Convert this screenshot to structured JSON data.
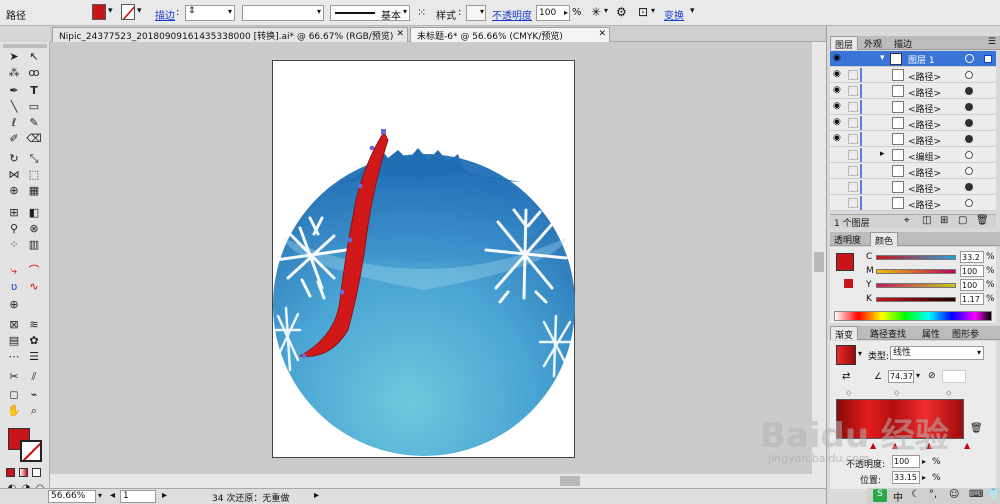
{
  "control_bar": {
    "object_type": "路径",
    "stroke_label": "描边",
    "brush_label": "基本",
    "style_label": "样式",
    "opacity_label": "不透明度",
    "opacity_value": "100",
    "opacity_unit": "%",
    "transform_label": "变换"
  },
  "document_tabs": [
    {
      "label": "Nipic_24377523_20180909161435338000 [转换].ai* @ 66.67% (RGB/预览)"
    },
    {
      "label": "未标题-6* @ 56.66% (CMYK/预览)"
    }
  ],
  "status_bar": {
    "zoom": "56.66%",
    "page": "1",
    "undo_text": "34 次还原：无重做"
  },
  "layers_panel": {
    "tabs": [
      "图层",
      "外观",
      "描边"
    ],
    "layer_name": "图层 1",
    "items": [
      {
        "label": "<路径>",
        "target": "hollow"
      },
      {
        "label": "<路径>",
        "target": "filled"
      },
      {
        "label": "<路径>",
        "target": "filled"
      },
      {
        "label": "<路径>",
        "target": "filled"
      },
      {
        "label": "<路径>",
        "target": "filled"
      },
      {
        "label": "<编组>",
        "target": "hollow"
      },
      {
        "label": "<路径>",
        "target": "hollow"
      },
      {
        "label": "<路径>",
        "target": "filled"
      },
      {
        "label": "<路径>",
        "target": "hollow"
      }
    ],
    "footer": "1 个图层"
  },
  "color_panel": {
    "tabs": [
      "透明度",
      "颜色"
    ],
    "sliders": [
      {
        "label": "C",
        "value": "33.2",
        "unit": "%"
      },
      {
        "label": "M",
        "value": "100",
        "unit": "%"
      },
      {
        "label": "Y",
        "value": "100",
        "unit": "%"
      },
      {
        "label": "K",
        "value": "1.17",
        "unit": "%"
      }
    ]
  },
  "gradient_panel": {
    "tabs": [
      "渐变",
      "路径查找",
      "属性",
      "图形参"
    ],
    "type_label": "类型:",
    "type_value": "线性",
    "angle_value": "74.37",
    "opacity_label": "不透明度:",
    "opacity_value": "100",
    "location_label": "位置:",
    "location_value": "33.15",
    "unit": "%"
  },
  "watermark": {
    "text": "Baidu 经验",
    "url": "jingyan.baidu.com"
  },
  "colors": {
    "fill": "#c8151b",
    "ornament_light": "#6ec8dc",
    "ornament_dark": "#2a76b8",
    "ribbon": "#d01818",
    "accent_blue": "#1a3ccf"
  }
}
